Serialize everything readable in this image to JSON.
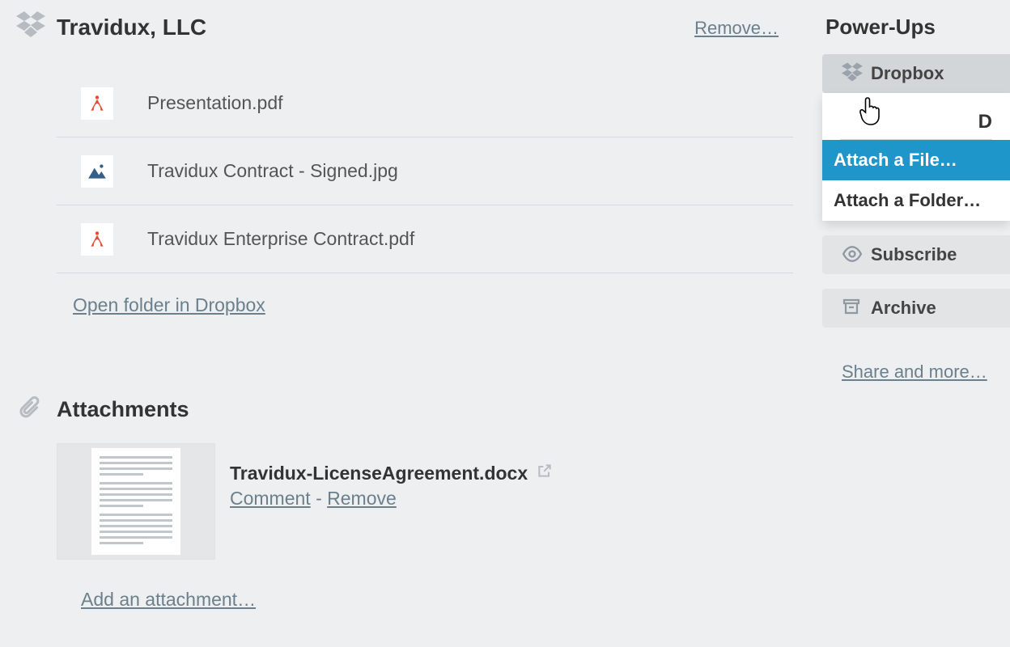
{
  "dropbox": {
    "title": "Travidux, LLC",
    "remove_label": "Remove…",
    "files": [
      {
        "name": "Presentation.pdf",
        "type": "pdf"
      },
      {
        "name": "Travidux Contract - Signed.jpg",
        "type": "image"
      },
      {
        "name": "Travidux Enterprise Contract.pdf",
        "type": "pdf"
      }
    ],
    "open_folder_label": "Open folder in Dropbox"
  },
  "attachments": {
    "title": "Attachments",
    "items": [
      {
        "name": "Travidux-LicenseAgreement.docx",
        "comment_label": "Comment",
        "remove_label": "Remove"
      }
    ],
    "add_label": "Add an attachment…"
  },
  "sidebar": {
    "powerups_heading": "Power-Ups",
    "dropbox_label": "Dropbox",
    "popout_partial": "D",
    "attach_file_label": "Attach a File…",
    "attach_folder_label": "Attach a Folder…",
    "subscribe_label": "Subscribe",
    "archive_label": "Archive",
    "share_label": "Share and more…"
  }
}
